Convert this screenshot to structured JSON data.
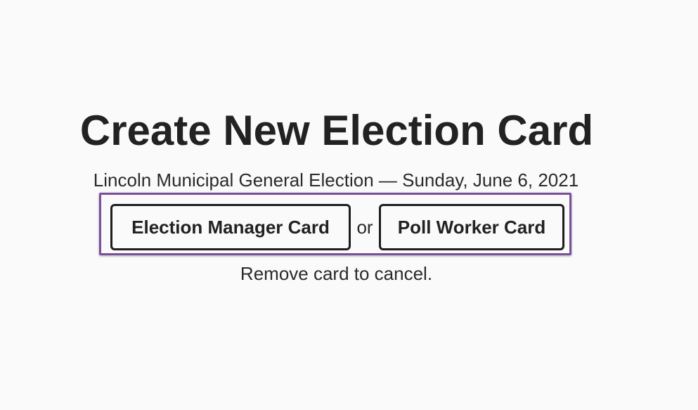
{
  "page": {
    "title": "Create New Election Card",
    "election_name": "Lincoln Municipal General Election",
    "separator": "—",
    "election_date": "Sunday, June 6, 2021",
    "subtitle": "Lincoln Municipal General Election — Sunday, June 6, 2021"
  },
  "actions": {
    "election_manager_label": "Election Manager Card",
    "or_label": "or",
    "poll_worker_label": "Poll Worker Card"
  },
  "footer": {
    "cancel_hint": "Remove card to cancel."
  },
  "colors": {
    "background": "#fafafa",
    "text": "#222222",
    "focus_outline": "#7a4f9c",
    "button_border": "#1d1d1d"
  }
}
